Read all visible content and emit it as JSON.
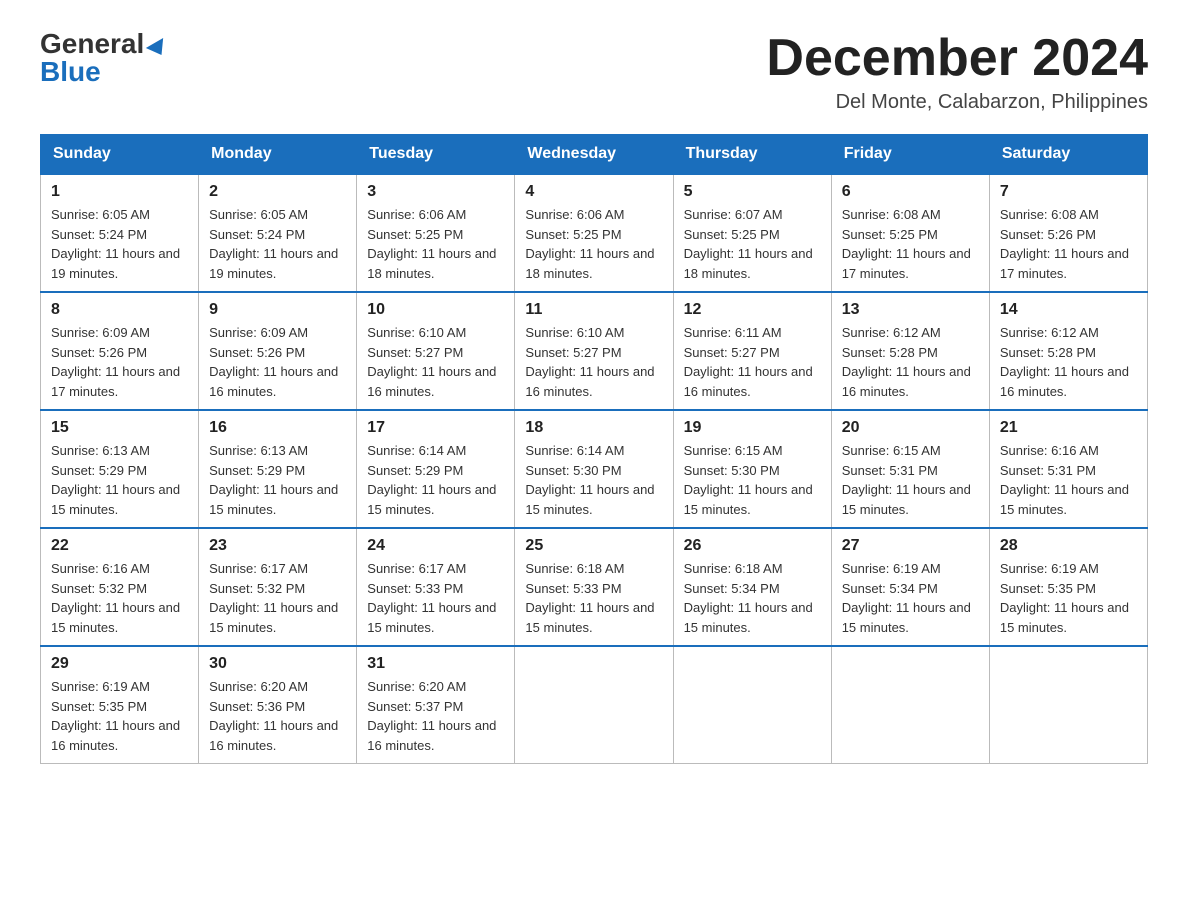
{
  "header": {
    "logo_general": "General",
    "logo_blue": "Blue",
    "month_title": "December 2024",
    "location": "Del Monte, Calabarzon, Philippines"
  },
  "days_of_week": [
    "Sunday",
    "Monday",
    "Tuesday",
    "Wednesday",
    "Thursday",
    "Friday",
    "Saturday"
  ],
  "weeks": [
    [
      {
        "num": "1",
        "sunrise": "6:05 AM",
        "sunset": "5:24 PM",
        "daylight": "11 hours and 19 minutes."
      },
      {
        "num": "2",
        "sunrise": "6:05 AM",
        "sunset": "5:24 PM",
        "daylight": "11 hours and 19 minutes."
      },
      {
        "num": "3",
        "sunrise": "6:06 AM",
        "sunset": "5:25 PM",
        "daylight": "11 hours and 18 minutes."
      },
      {
        "num": "4",
        "sunrise": "6:06 AM",
        "sunset": "5:25 PM",
        "daylight": "11 hours and 18 minutes."
      },
      {
        "num": "5",
        "sunrise": "6:07 AM",
        "sunset": "5:25 PM",
        "daylight": "11 hours and 18 minutes."
      },
      {
        "num": "6",
        "sunrise": "6:08 AM",
        "sunset": "5:25 PM",
        "daylight": "11 hours and 17 minutes."
      },
      {
        "num": "7",
        "sunrise": "6:08 AM",
        "sunset": "5:26 PM",
        "daylight": "11 hours and 17 minutes."
      }
    ],
    [
      {
        "num": "8",
        "sunrise": "6:09 AM",
        "sunset": "5:26 PM",
        "daylight": "11 hours and 17 minutes."
      },
      {
        "num": "9",
        "sunrise": "6:09 AM",
        "sunset": "5:26 PM",
        "daylight": "11 hours and 16 minutes."
      },
      {
        "num": "10",
        "sunrise": "6:10 AM",
        "sunset": "5:27 PM",
        "daylight": "11 hours and 16 minutes."
      },
      {
        "num": "11",
        "sunrise": "6:10 AM",
        "sunset": "5:27 PM",
        "daylight": "11 hours and 16 minutes."
      },
      {
        "num": "12",
        "sunrise": "6:11 AM",
        "sunset": "5:27 PM",
        "daylight": "11 hours and 16 minutes."
      },
      {
        "num": "13",
        "sunrise": "6:12 AM",
        "sunset": "5:28 PM",
        "daylight": "11 hours and 16 minutes."
      },
      {
        "num": "14",
        "sunrise": "6:12 AM",
        "sunset": "5:28 PM",
        "daylight": "11 hours and 16 minutes."
      }
    ],
    [
      {
        "num": "15",
        "sunrise": "6:13 AM",
        "sunset": "5:29 PM",
        "daylight": "11 hours and 15 minutes."
      },
      {
        "num": "16",
        "sunrise": "6:13 AM",
        "sunset": "5:29 PM",
        "daylight": "11 hours and 15 minutes."
      },
      {
        "num": "17",
        "sunrise": "6:14 AM",
        "sunset": "5:29 PM",
        "daylight": "11 hours and 15 minutes."
      },
      {
        "num": "18",
        "sunrise": "6:14 AM",
        "sunset": "5:30 PM",
        "daylight": "11 hours and 15 minutes."
      },
      {
        "num": "19",
        "sunrise": "6:15 AM",
        "sunset": "5:30 PM",
        "daylight": "11 hours and 15 minutes."
      },
      {
        "num": "20",
        "sunrise": "6:15 AM",
        "sunset": "5:31 PM",
        "daylight": "11 hours and 15 minutes."
      },
      {
        "num": "21",
        "sunrise": "6:16 AM",
        "sunset": "5:31 PM",
        "daylight": "11 hours and 15 minutes."
      }
    ],
    [
      {
        "num": "22",
        "sunrise": "6:16 AM",
        "sunset": "5:32 PM",
        "daylight": "11 hours and 15 minutes."
      },
      {
        "num": "23",
        "sunrise": "6:17 AM",
        "sunset": "5:32 PM",
        "daylight": "11 hours and 15 minutes."
      },
      {
        "num": "24",
        "sunrise": "6:17 AM",
        "sunset": "5:33 PM",
        "daylight": "11 hours and 15 minutes."
      },
      {
        "num": "25",
        "sunrise": "6:18 AM",
        "sunset": "5:33 PM",
        "daylight": "11 hours and 15 minutes."
      },
      {
        "num": "26",
        "sunrise": "6:18 AM",
        "sunset": "5:34 PM",
        "daylight": "11 hours and 15 minutes."
      },
      {
        "num": "27",
        "sunrise": "6:19 AM",
        "sunset": "5:34 PM",
        "daylight": "11 hours and 15 minutes."
      },
      {
        "num": "28",
        "sunrise": "6:19 AM",
        "sunset": "5:35 PM",
        "daylight": "11 hours and 15 minutes."
      }
    ],
    [
      {
        "num": "29",
        "sunrise": "6:19 AM",
        "sunset": "5:35 PM",
        "daylight": "11 hours and 16 minutes."
      },
      {
        "num": "30",
        "sunrise": "6:20 AM",
        "sunset": "5:36 PM",
        "daylight": "11 hours and 16 minutes."
      },
      {
        "num": "31",
        "sunrise": "6:20 AM",
        "sunset": "5:37 PM",
        "daylight": "11 hours and 16 minutes."
      },
      null,
      null,
      null,
      null
    ]
  ]
}
